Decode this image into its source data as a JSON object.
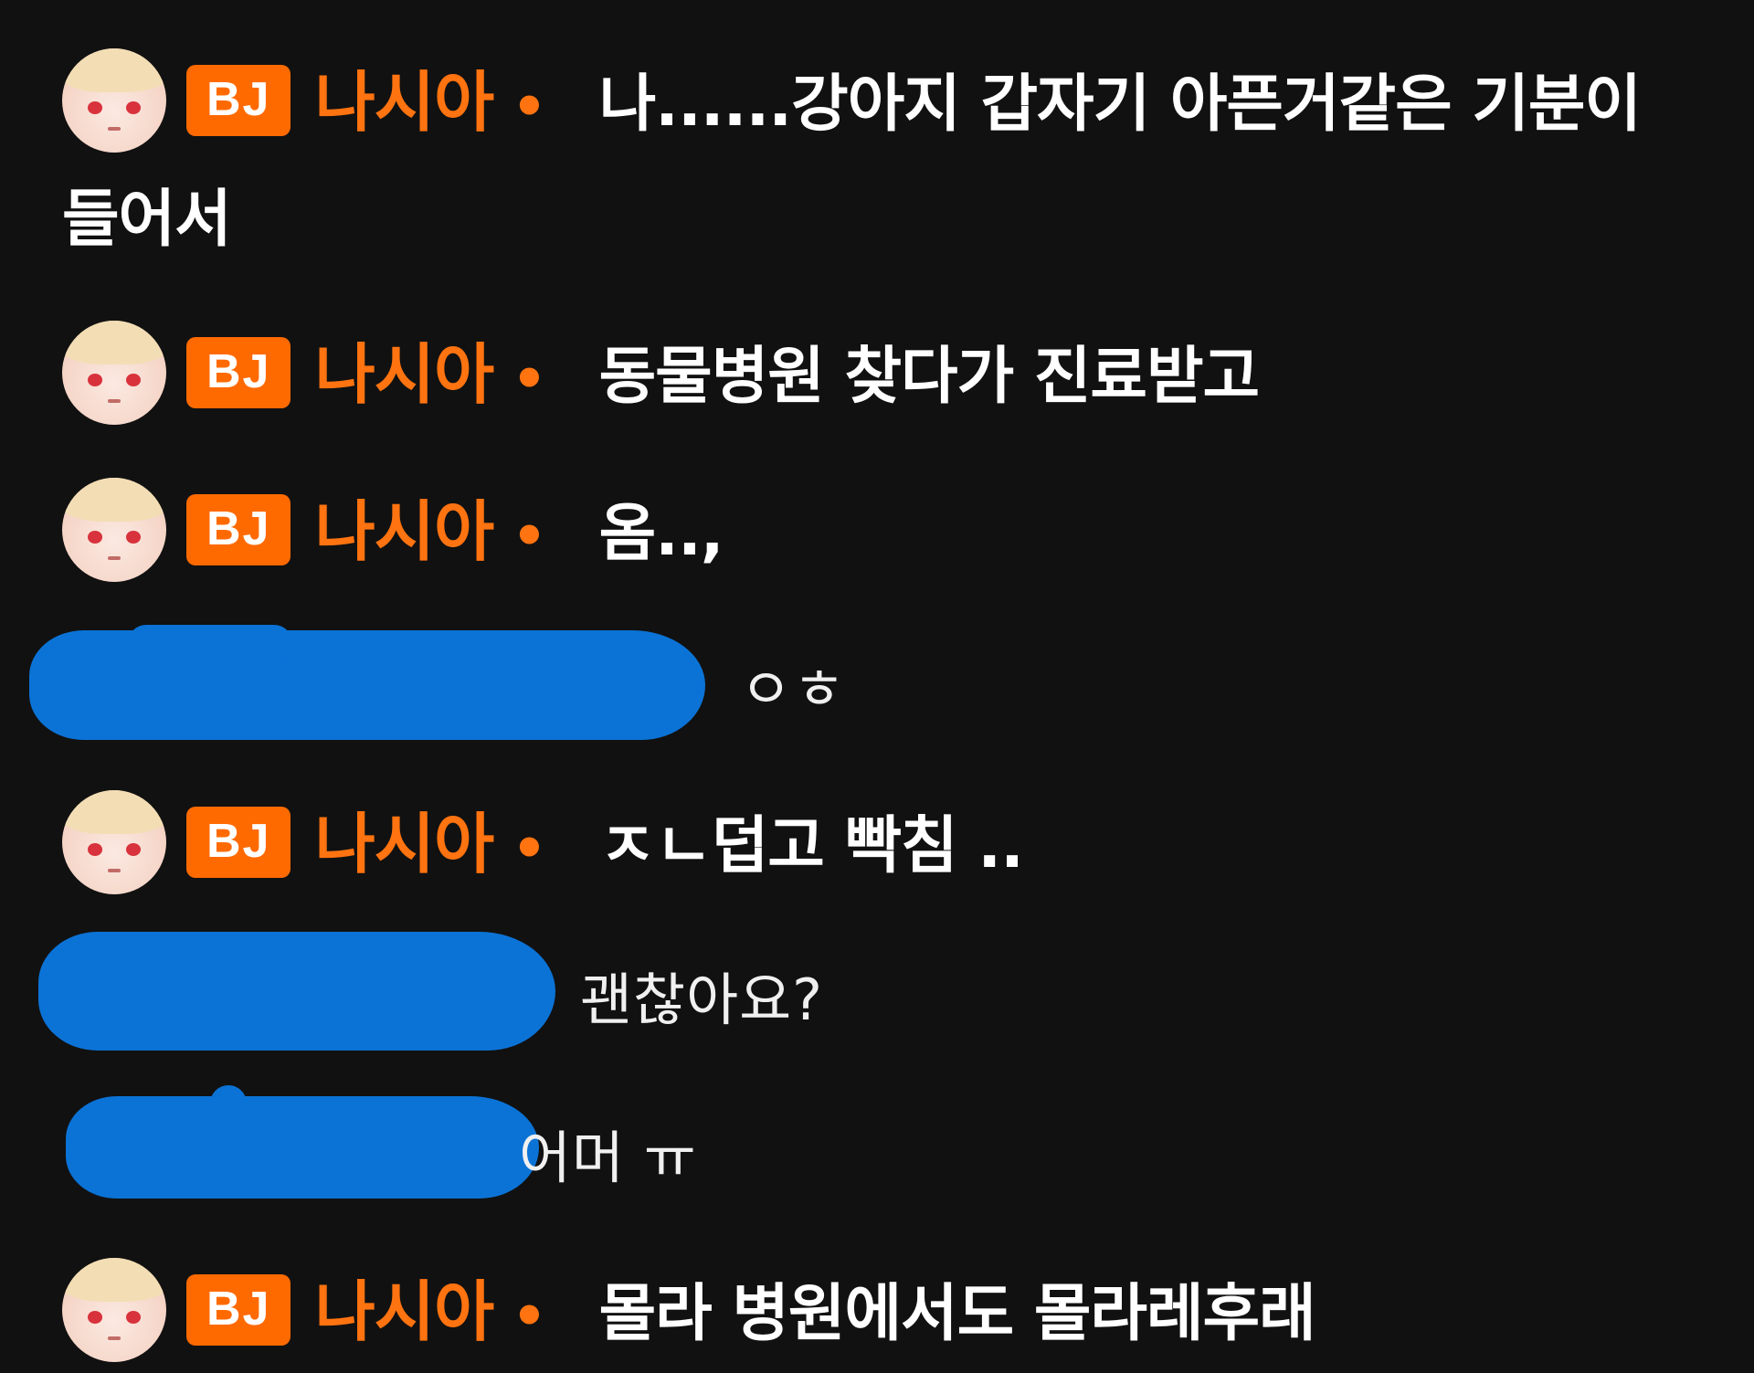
{
  "theme": {
    "background": "#111111",
    "badge_color": "#ff6a00",
    "nick_color": "#ff7310",
    "redaction_color": "#0b73d6"
  },
  "messages": [
    {
      "badge": "BJ",
      "nick": "나시아",
      "separator": "•",
      "text": "나......강아지 갑자기 아픈거같은 기분이 들어서"
    },
    {
      "badge": "BJ",
      "nick": "나시아",
      "separator": "•",
      "text": "동물병원 찾다가 진료받고"
    },
    {
      "badge": "BJ",
      "nick": "나시아",
      "separator": "•",
      "text": "옴..,"
    },
    {
      "redacted": true,
      "text": "ㅇㅎ"
    },
    {
      "badge": "BJ",
      "nick": "나시아",
      "separator": "•",
      "text": "ㅈㄴ덥고 빡침 .."
    },
    {
      "redacted": true,
      "text": "괜찮아요?"
    },
    {
      "redacted": true,
      "text": "어머 ㅠ"
    },
    {
      "badge": "BJ",
      "nick": "나시아",
      "separator": "•",
      "text": "몰라 병원에서도 몰라레후래"
    }
  ]
}
